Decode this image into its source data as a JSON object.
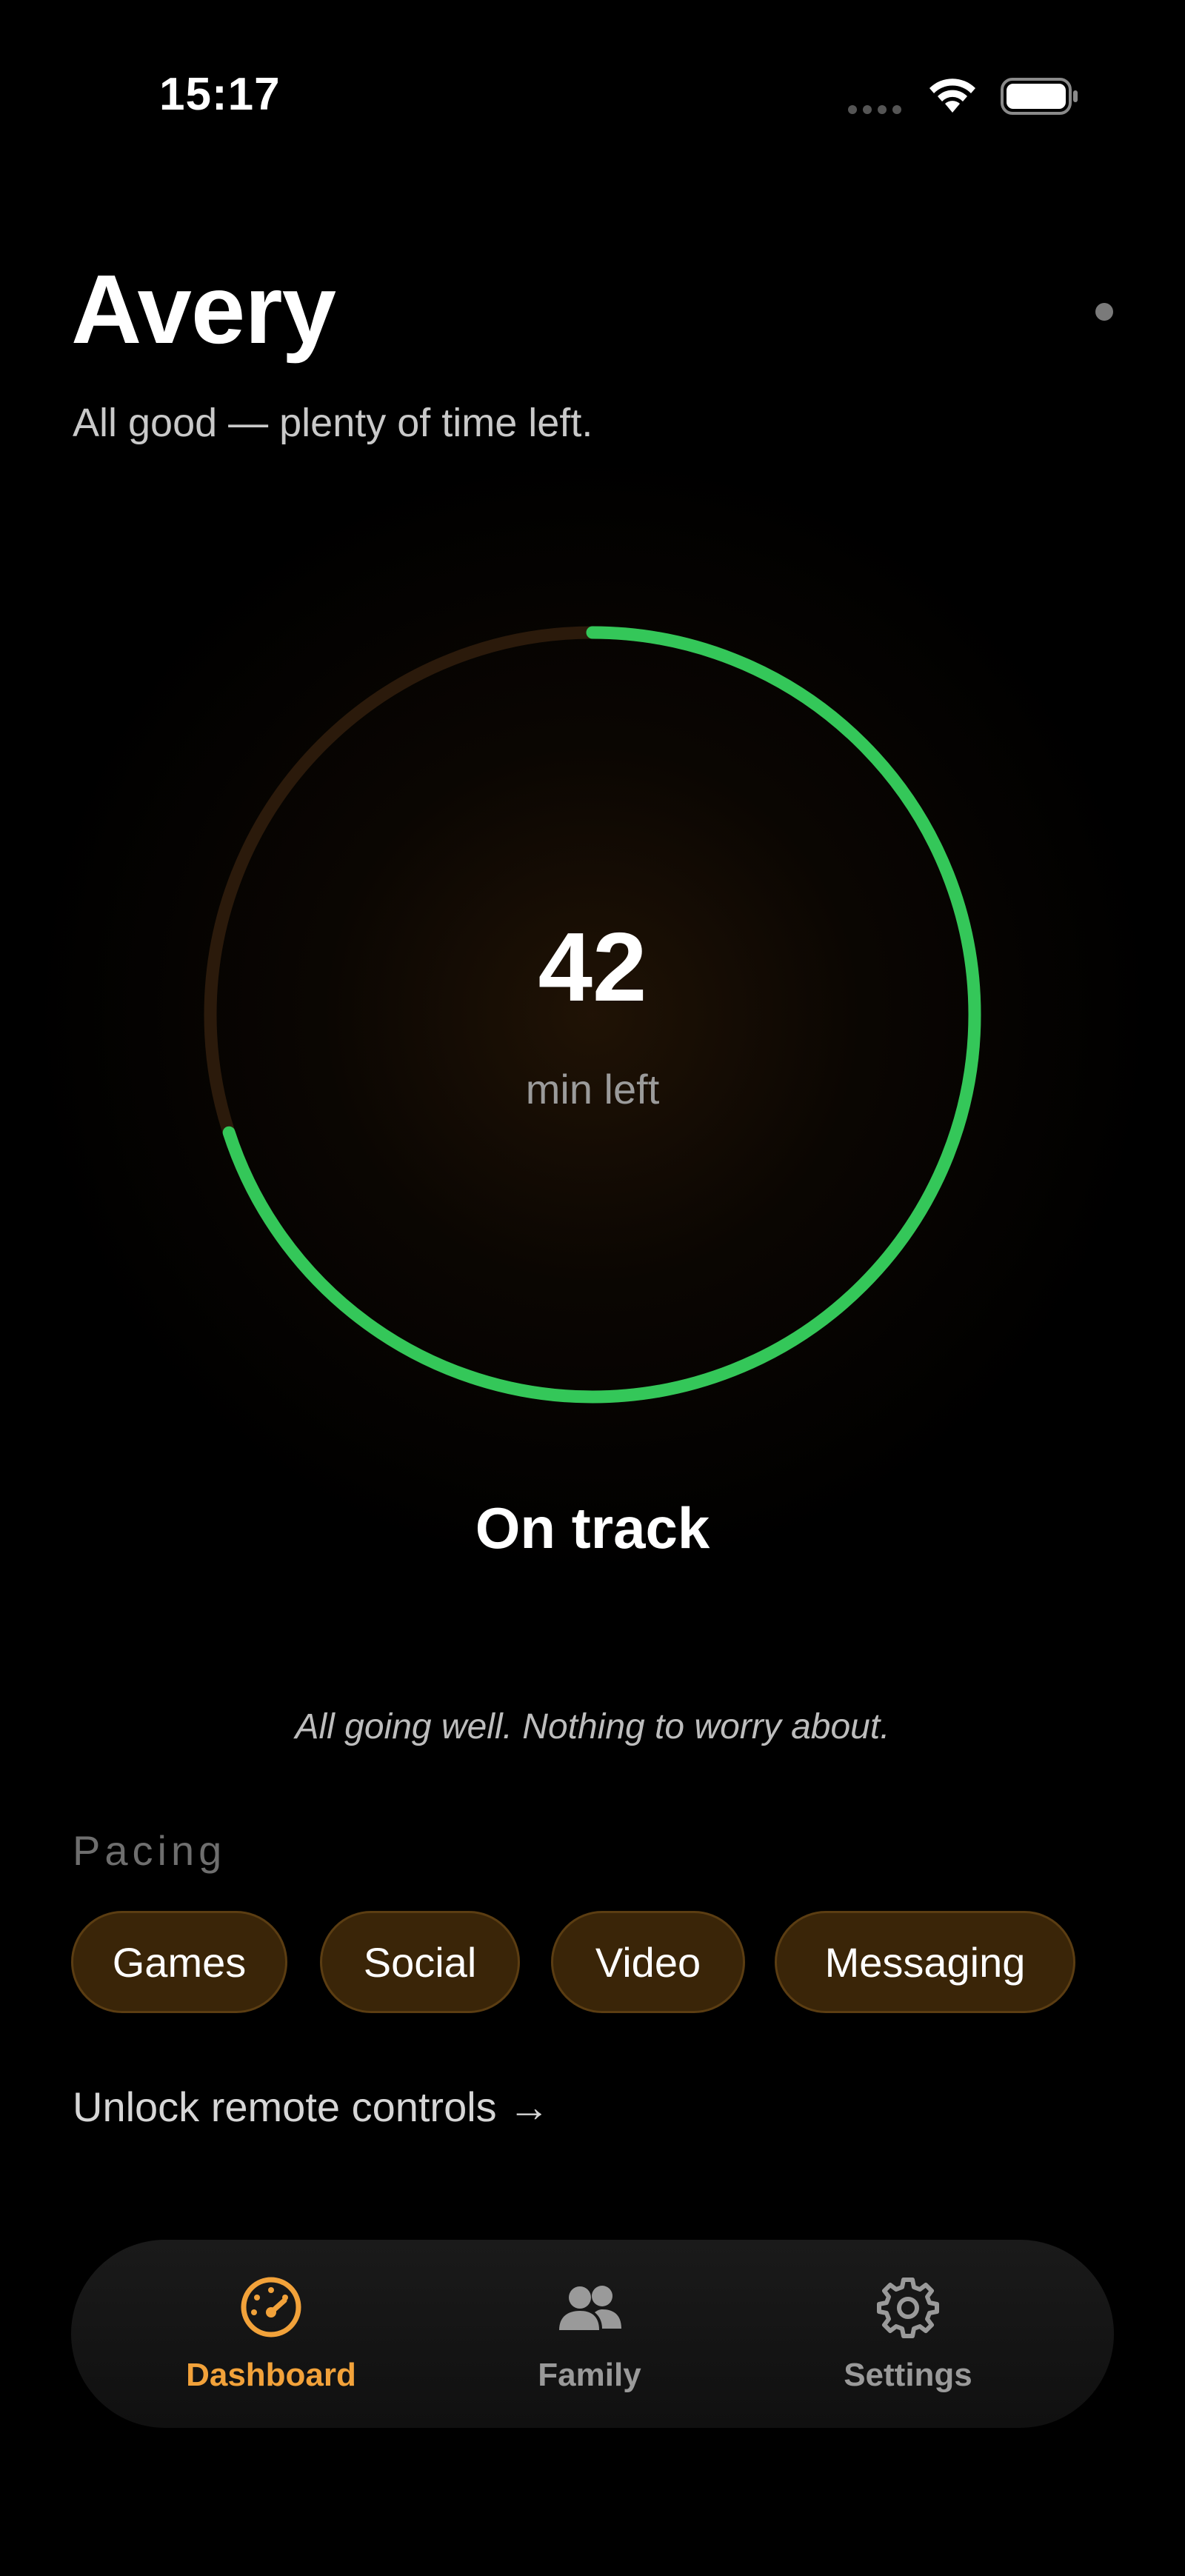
{
  "status_bar": {
    "time": "15:17"
  },
  "header": {
    "name": "Avery",
    "subtitle": "All good — plenty of time left."
  },
  "ring": {
    "value": "42",
    "unit": "min left",
    "fraction_remaining": 0.7,
    "progress_color": "#34c759",
    "track_color": "#2b1a0b"
  },
  "status": {
    "label": "On track",
    "note": "All going well. Nothing to worry about."
  },
  "pacing": {
    "label": "Pacing",
    "chips": [
      "Games",
      "Social",
      "Video",
      "Messaging"
    ]
  },
  "unlock_link": "Unlock remote controls →",
  "tab_bar": {
    "active_color": "#f2a23a",
    "tabs": [
      {
        "label": "Dashboard",
        "icon": "dashboard-gauge-icon"
      },
      {
        "label": "Family",
        "icon": "family-people-icon"
      },
      {
        "label": "Settings",
        "icon": "gear-icon"
      }
    ]
  }
}
